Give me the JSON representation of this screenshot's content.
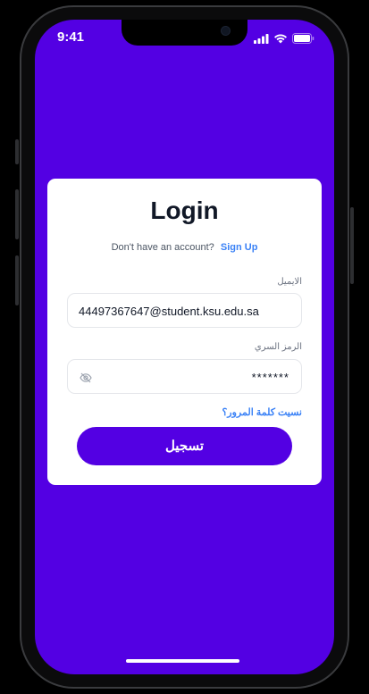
{
  "status_bar": {
    "time": "9:41",
    "icons": [
      "signal-icon",
      "wifi-icon",
      "battery-icon"
    ]
  },
  "login": {
    "title": "Login",
    "signup_prompt": "Don't have an account?",
    "signup_link": "Sign Up",
    "email_label": "الايميل",
    "email_value": "44497367647@student.ksu.edu.sa",
    "password_label": "الرمز السري",
    "password_value": "*******",
    "password_visibility_icon": "eye-off-icon",
    "forgot_link": "نسيت كلمة المرور؟",
    "submit_label": "تسجيل"
  },
  "colors": {
    "background": "#5300e3",
    "card": "#ffffff",
    "link": "#3b82f6",
    "button": "#5300e3",
    "title": "#111827"
  }
}
